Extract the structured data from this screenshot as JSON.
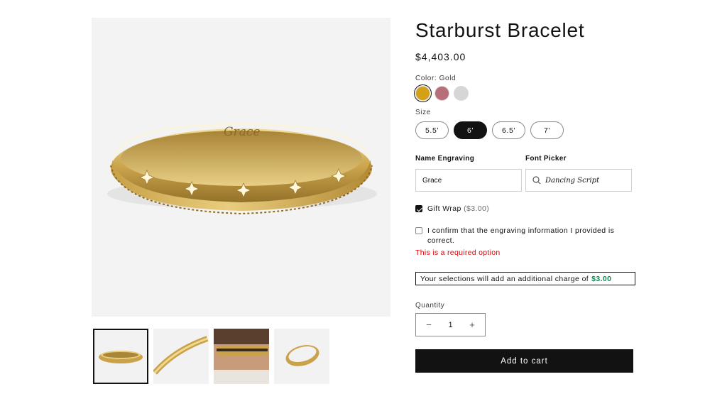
{
  "product": {
    "title": "Starburst Bracelet",
    "price": "$4,403.00",
    "engraving_preview": "Grace"
  },
  "color": {
    "label": "Color: Gold",
    "swatches": [
      {
        "name": "Gold",
        "hex": "#d4a017",
        "selected": true
      },
      {
        "name": "Rose",
        "hex": "#b76e79",
        "selected": false
      },
      {
        "name": "Silver",
        "hex": "#d6d6d6",
        "selected": false
      }
    ]
  },
  "size": {
    "label": "Size",
    "options": [
      "5.5'",
      "6'",
      "6.5'",
      "7'"
    ],
    "selected": "6'"
  },
  "engraving": {
    "name_label": "Name Engraving",
    "name_value": "Grace",
    "font_label": "Font Picker",
    "font_value": "Dancing Script"
  },
  "gift_wrap": {
    "label": "Gift Wrap",
    "price": "($3.00)",
    "checked": true
  },
  "confirm": {
    "label": "I confirm that the engraving information I provided is correct.",
    "checked": false,
    "error": "This is a required option"
  },
  "charge": {
    "text": "Your selections will add an additional charge of",
    "amount": "$3.00",
    "amount_color": "#0e8a4e"
  },
  "quantity": {
    "label": "Quantity",
    "value": "1",
    "minus": "−",
    "plus": "+"
  },
  "cart": {
    "label": "Add to cart"
  },
  "colors": {
    "accent": "#121212",
    "error": "#e00000",
    "gold": "#d4a017"
  }
}
